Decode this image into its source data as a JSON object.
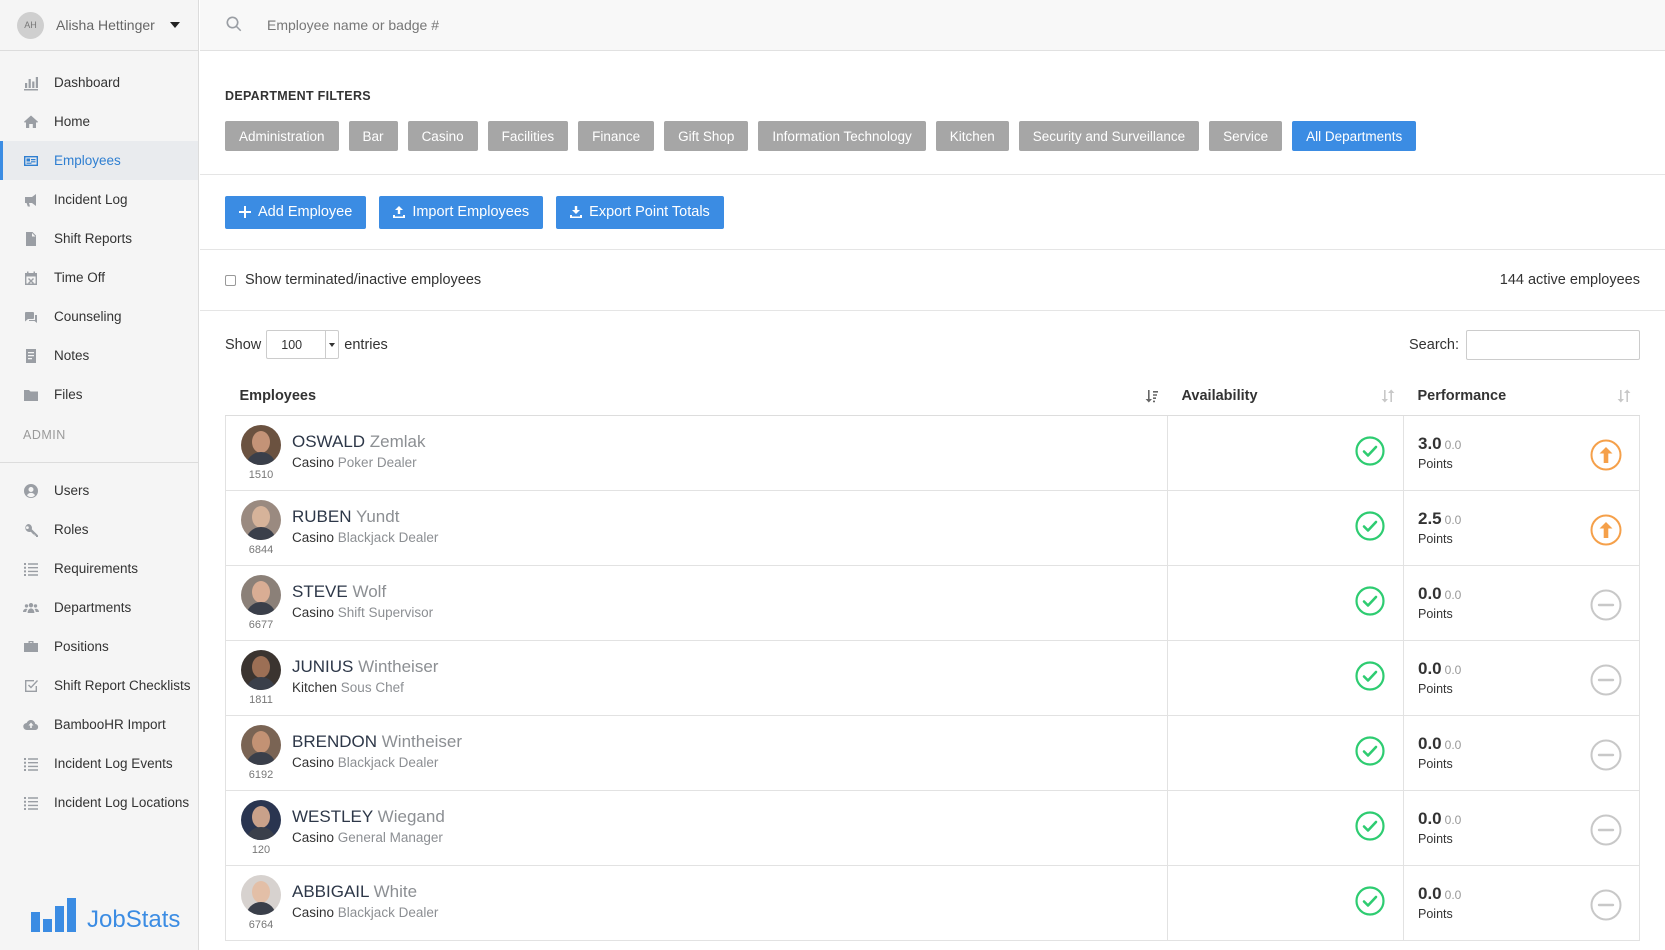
{
  "user": {
    "initials": "AH",
    "name": "Alisha Hettinger"
  },
  "nav": [
    {
      "label": "Dashboard",
      "icon": "bar-chart-icon"
    },
    {
      "label": "Home",
      "icon": "home-icon"
    },
    {
      "label": "Employees",
      "icon": "id-card-icon",
      "active": true
    },
    {
      "label": "Incident Log",
      "icon": "megaphone-icon"
    },
    {
      "label": "Shift Reports",
      "icon": "file-icon"
    },
    {
      "label": "Time Off",
      "icon": "calendar-x-icon"
    },
    {
      "label": "Counseling",
      "icon": "chat-icon"
    },
    {
      "label": "Notes",
      "icon": "note-icon"
    },
    {
      "label": "Files",
      "icon": "folder-icon"
    }
  ],
  "admin_label": "ADMIN",
  "admin_nav": [
    {
      "label": "Users",
      "icon": "user-icon"
    },
    {
      "label": "Roles",
      "icon": "key-icon"
    },
    {
      "label": "Requirements",
      "icon": "list-icon"
    },
    {
      "label": "Departments",
      "icon": "group-icon"
    },
    {
      "label": "Positions",
      "icon": "briefcase-icon"
    },
    {
      "label": "Shift Report Checklists",
      "icon": "checkbox-icon"
    },
    {
      "label": "BambooHR Import",
      "icon": "cloud-icon"
    },
    {
      "label": "Incident Log Events",
      "icon": "list-icon"
    },
    {
      "label": "Incident Log Locations",
      "icon": "list-icon"
    }
  ],
  "logo": {
    "text": "JobStats",
    "color": "#3b8ce3"
  },
  "search": {
    "placeholder": "Employee name or badge #"
  },
  "filters": {
    "title": "DEPARTMENT FILTERS",
    "items": [
      "Administration",
      "Bar",
      "Casino",
      "Facilities",
      "Finance",
      "Gift Shop",
      "Information Technology",
      "Kitchen",
      "Security and Surveillance",
      "Service",
      "All Departments"
    ],
    "active": "All Departments"
  },
  "actions": {
    "add": "Add Employee",
    "import": "Import Employees",
    "export": "Export Point Totals"
  },
  "toggle": {
    "label": "Show terminated/inactive employees",
    "active_count": "144 active employees"
  },
  "table_controls": {
    "show": "Show",
    "entries_value": "100",
    "entries": "entries",
    "search_label": "Search:"
  },
  "columns": {
    "employees": "Employees",
    "availability": "Availability",
    "performance": "Performance"
  },
  "points_label": "Points",
  "rows": [
    {
      "first": "OSWALD",
      "last": "Zemlak",
      "badge": "1510",
      "dept": "Casino",
      "position": "Poker Dealer",
      "points": "3.0",
      "points_sub": "0.0",
      "trend": "up"
    },
    {
      "first": "RUBEN",
      "last": "Yundt",
      "badge": "6844",
      "dept": "Casino",
      "position": "Blackjack Dealer",
      "points": "2.5",
      "points_sub": "0.0",
      "trend": "up"
    },
    {
      "first": "STEVE",
      "last": "Wolf",
      "badge": "6677",
      "dept": "Casino",
      "position": "Shift Supervisor",
      "points": "0.0",
      "points_sub": "0.0",
      "trend": "neutral"
    },
    {
      "first": "JUNIUS",
      "last": "Wintheiser",
      "badge": "1811",
      "dept": "Kitchen",
      "position": "Sous Chef",
      "points": "0.0",
      "points_sub": "0.0",
      "trend": "neutral"
    },
    {
      "first": "BRENDON",
      "last": "Wintheiser",
      "badge": "6192",
      "dept": "Casino",
      "position": "Blackjack Dealer",
      "points": "0.0",
      "points_sub": "0.0",
      "trend": "neutral"
    },
    {
      "first": "WESTLEY",
      "last": "Wiegand",
      "badge": "120",
      "dept": "Casino",
      "position": "General Manager",
      "points": "0.0",
      "points_sub": "0.0",
      "trend": "neutral"
    },
    {
      "first": "ABBIGAIL",
      "last": "White",
      "badge": "6764",
      "dept": "Casino",
      "position": "Blackjack Dealer",
      "points": "0.0",
      "points_sub": "0.0",
      "trend": "neutral"
    }
  ],
  "colors": {
    "accent": "#3b8ce3",
    "check": "#2ecc71",
    "trend_up": "#f5a04a",
    "neutral": "#c8c8c8",
    "filter_inactive": "#a6a6a6"
  }
}
